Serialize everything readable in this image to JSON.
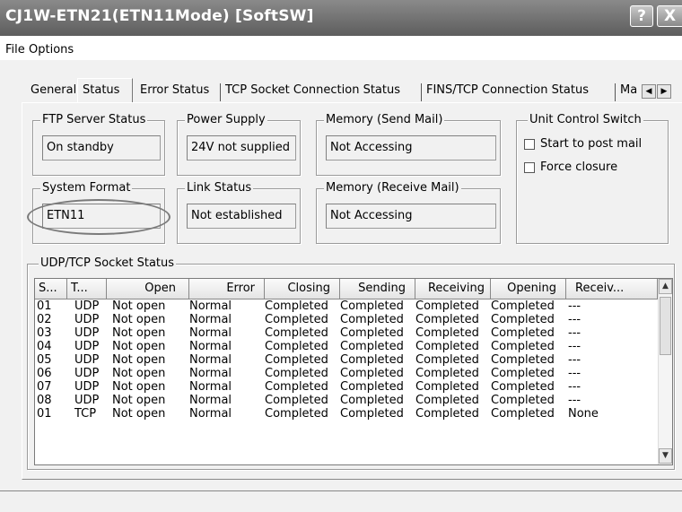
{
  "window": {
    "title": "CJ1W-ETN21(ETN11Mode) [SoftSW]",
    "help_button": "?",
    "close_button": "X"
  },
  "menu": [
    "File",
    "Options"
  ],
  "tabs": [
    "General",
    "Status",
    "Error Status",
    "TCP Socket Connection Status",
    "FINS/TCP Connection Status",
    "Ma"
  ],
  "active_tab": "Status",
  "groups": {
    "ftp_server_status": {
      "label": "FTP Server Status",
      "value": "On standby"
    },
    "power_supply": {
      "label": "Power Supply",
      "value": "24V not supplied"
    },
    "memory_send_mail": {
      "label": "Memory (Send Mail)",
      "value": "Not Accessing"
    },
    "unit_control_switch": {
      "label": "Unit Control Switch",
      "options": [
        "Start to post mail",
        "Force closure"
      ]
    },
    "system_format": {
      "label": "System Format",
      "value": "ETN11"
    },
    "link_status": {
      "label": "Link Status",
      "value": "Not established"
    },
    "memory_receive_mail": {
      "label": "Memory (Receive Mail)",
      "value": "Not Accessing"
    }
  },
  "socket_status": {
    "label": "UDP/TCP Socket Status",
    "columns": [
      "S...",
      "T...",
      "Open",
      "Error",
      "Closing",
      "Sending",
      "Receiving",
      "Opening",
      "Receiv..."
    ],
    "rows": [
      [
        "01",
        "UDP",
        "Not open",
        "Normal",
        "Completed",
        "Completed",
        "Completed",
        "Completed",
        "---"
      ],
      [
        "02",
        "UDP",
        "Not open",
        "Normal",
        "Completed",
        "Completed",
        "Completed",
        "Completed",
        "---"
      ],
      [
        "03",
        "UDP",
        "Not open",
        "Normal",
        "Completed",
        "Completed",
        "Completed",
        "Completed",
        "---"
      ],
      [
        "04",
        "UDP",
        "Not open",
        "Normal",
        "Completed",
        "Completed",
        "Completed",
        "Completed",
        "---"
      ],
      [
        "05",
        "UDP",
        "Not open",
        "Normal",
        "Completed",
        "Completed",
        "Completed",
        "Completed",
        "---"
      ],
      [
        "06",
        "UDP",
        "Not open",
        "Normal",
        "Completed",
        "Completed",
        "Completed",
        "Completed",
        "---"
      ],
      [
        "07",
        "UDP",
        "Not open",
        "Normal",
        "Completed",
        "Completed",
        "Completed",
        "Completed",
        "---"
      ],
      [
        "08",
        "UDP",
        "Not open",
        "Normal",
        "Completed",
        "Completed",
        "Completed",
        "Completed",
        "---"
      ],
      [
        "01",
        "TCP",
        "Not open",
        "Normal",
        "Completed",
        "Completed",
        "Completed",
        "Completed",
        "None"
      ]
    ]
  },
  "icons": {
    "tab_scroll_left": "left-arrow-icon",
    "tab_scroll_right": "right-arrow-icon",
    "scroll_up": "up-arrow-icon",
    "scroll_down": "down-arrow-icon"
  }
}
